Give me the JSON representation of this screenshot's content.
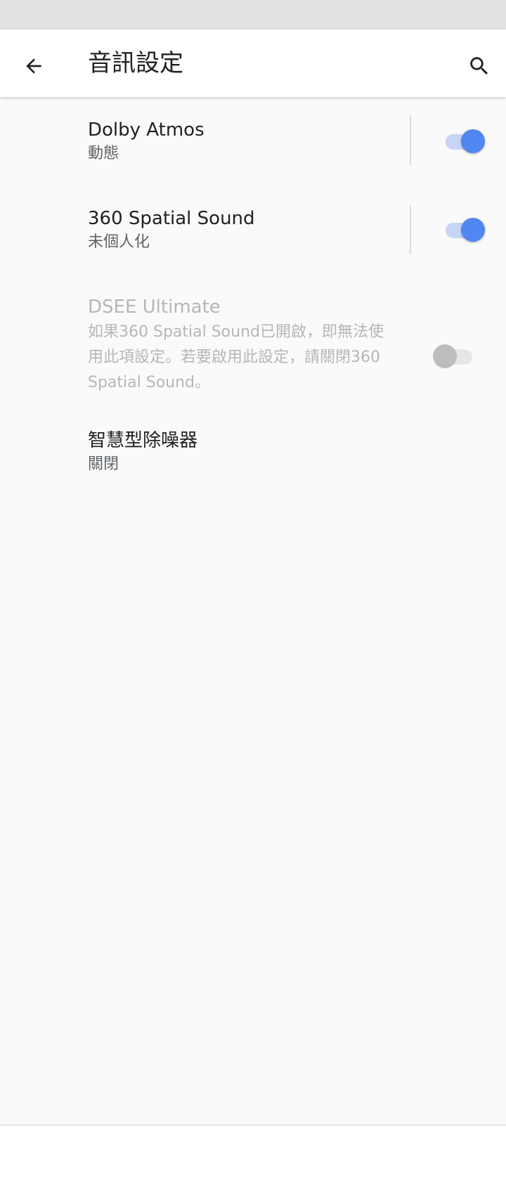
{
  "app_bar": {
    "title": "音訊設定",
    "back_icon": "arrow-back-icon",
    "search_icon": "search-icon"
  },
  "settings": [
    {
      "title": "Dolby Atmos",
      "summary": "動態",
      "switch_on": true,
      "enabled": true
    },
    {
      "title": "360 Spatial Sound",
      "summary": "未個人化",
      "switch_on": true,
      "enabled": true
    },
    {
      "title": "DSEE Ultimate",
      "summary_lines": [
        "如果360 Spatial Sound已開啟，即無法使",
        "用此項設定。若要啟用此設定，請關閉360",
        "Spatial Sound。"
      ],
      "switch_on": false,
      "enabled": false
    },
    {
      "title": "智慧型除噪器",
      "summary": "關閉"
    }
  ],
  "colors": {
    "accent": "#5286f0",
    "accent_track": "#c6d5f7",
    "disabled_text": "#b6b6b6"
  }
}
